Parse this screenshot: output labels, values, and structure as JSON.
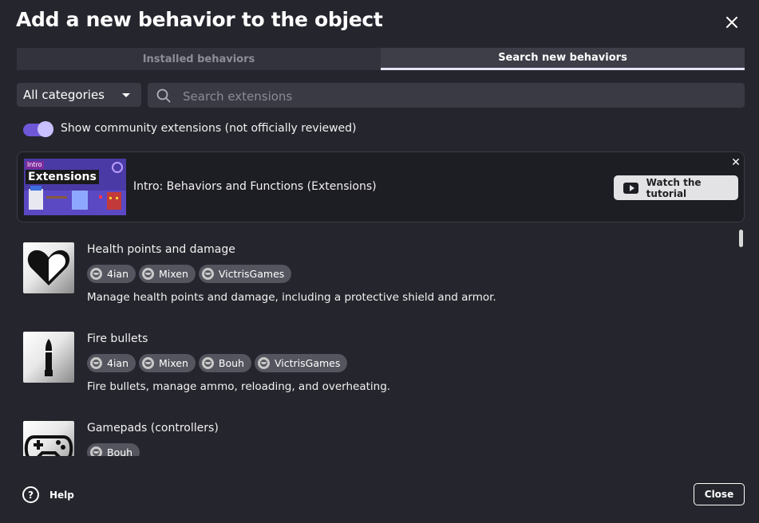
{
  "dialog": {
    "title": "Add a new behavior to the object"
  },
  "tabs": [
    {
      "label": "Installed behaviors",
      "active": false
    },
    {
      "label": "Search new behaviors",
      "active": true
    }
  ],
  "filters": {
    "category": "All categories",
    "search_placeholder": "Search extensions",
    "search_value": ""
  },
  "community_toggle": {
    "label": "Show community extensions (not officially reviewed)",
    "on": true
  },
  "tutorial_banner": {
    "thumbnail_tag": "Intro",
    "thumbnail_title": "Extensions",
    "title": "Intro: Behaviors and Functions (Extensions)",
    "button_label": "Watch the tutorial"
  },
  "extensions": [
    {
      "name": "Health points and damage",
      "icon": "heart-icon",
      "authors": [
        "4ian",
        "Mixen",
        "VictrisGames"
      ],
      "description": "Manage health points and damage, including a protective shield and armor."
    },
    {
      "name": "Fire bullets",
      "icon": "bullet-icon",
      "authors": [
        "4ian",
        "Mixen",
        "Bouh",
        "VictrisGames"
      ],
      "description": "Fire bullets, manage ammo, reloading, and overheating."
    },
    {
      "name": "Gamepads (controllers)",
      "icon": "gamepad-icon",
      "authors": [
        "Bouh"
      ],
      "description": ""
    }
  ],
  "footer": {
    "help_label": "Help",
    "close_label": "Close"
  },
  "colors": {
    "background": "#25252d",
    "accent": "#6e58d8",
    "tab_underline": "#e7e4ff"
  }
}
